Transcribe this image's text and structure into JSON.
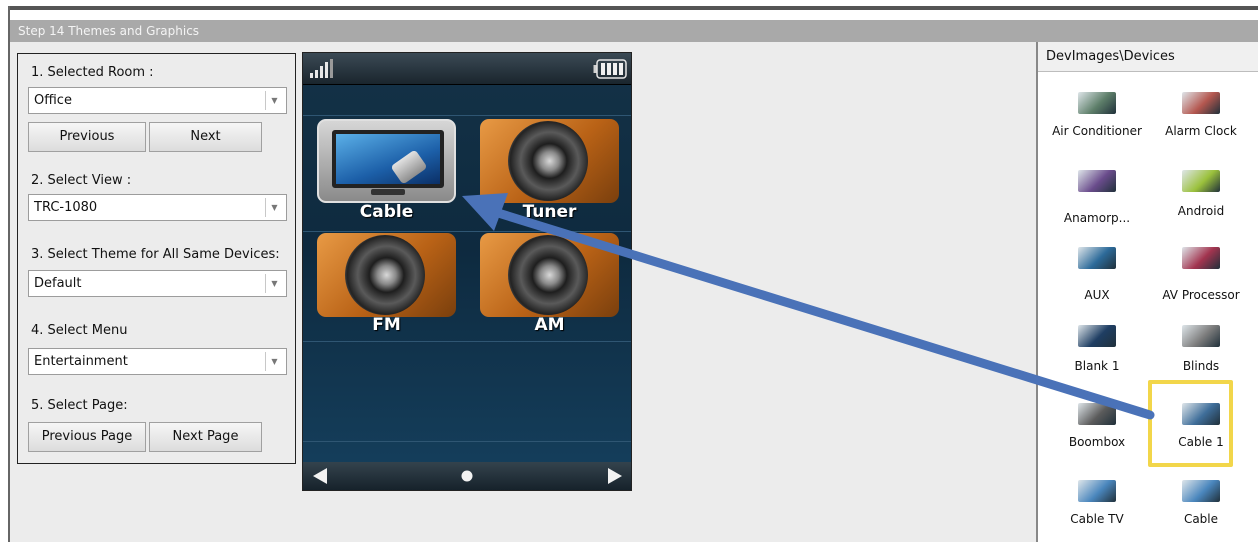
{
  "window": {
    "title": "Step 14 Themes and Graphics"
  },
  "settings": {
    "room_label": "1. Selected Room :",
    "room_value": "Office",
    "prev_button": "Previous",
    "next_button": "Next",
    "view_label": "2. Select View :",
    "view_value": "TRC-1080",
    "theme_label": "3. Select Theme for All Same Devices:",
    "theme_value": "Default",
    "menu_label": "4. Select Menu",
    "menu_value": "Entertainment",
    "page_label": "5. Select Page:",
    "prev_page_button": "Previous Page",
    "next_page_button": "Next Page"
  },
  "phone": {
    "tiles": [
      {
        "label": "Cable",
        "icon": "tv-cable-icon"
      },
      {
        "label": "Tuner",
        "icon": "speaker-icon"
      },
      {
        "label": "FM",
        "icon": "speaker-icon"
      },
      {
        "label": "AM",
        "icon": "speaker-icon"
      }
    ],
    "status_icons": [
      "signal-icon",
      "battery-icon"
    ],
    "nav_icons": [
      "left-arrow-icon",
      "page-dot-icon",
      "right-arrow-icon"
    ]
  },
  "devices": {
    "path": "DevImages\\Devices",
    "items": [
      {
        "name": "Air Conditioner",
        "color": "#5e7f6a"
      },
      {
        "name": "Alarm Clock",
        "color": "#b4574f"
      },
      {
        "name": "Anamorp...",
        "color": "#6a4c8c"
      },
      {
        "name": "Android",
        "color": "#9bc13c"
      },
      {
        "name": "AUX",
        "color": "#2d6b9a"
      },
      {
        "name": "AV Processor",
        "color": "#a2344f"
      },
      {
        "name": "Blank 1",
        "color": "#1f3e63"
      },
      {
        "name": "Blinds",
        "color": "#7d7d7d"
      },
      {
        "name": "Boombox",
        "color": "#5b5b5b"
      },
      {
        "name": "Cable 1",
        "color": "#3f6e9a"
      },
      {
        "name": "Cable TV",
        "color": "#4a86bd"
      },
      {
        "name": "Cable",
        "color": "#4a86bd"
      }
    ],
    "selected": "Cable 1"
  },
  "colors": {
    "highlight": "#f2d64a",
    "arrow": "#4a72b8",
    "accent_orange": "#d07a2a"
  }
}
